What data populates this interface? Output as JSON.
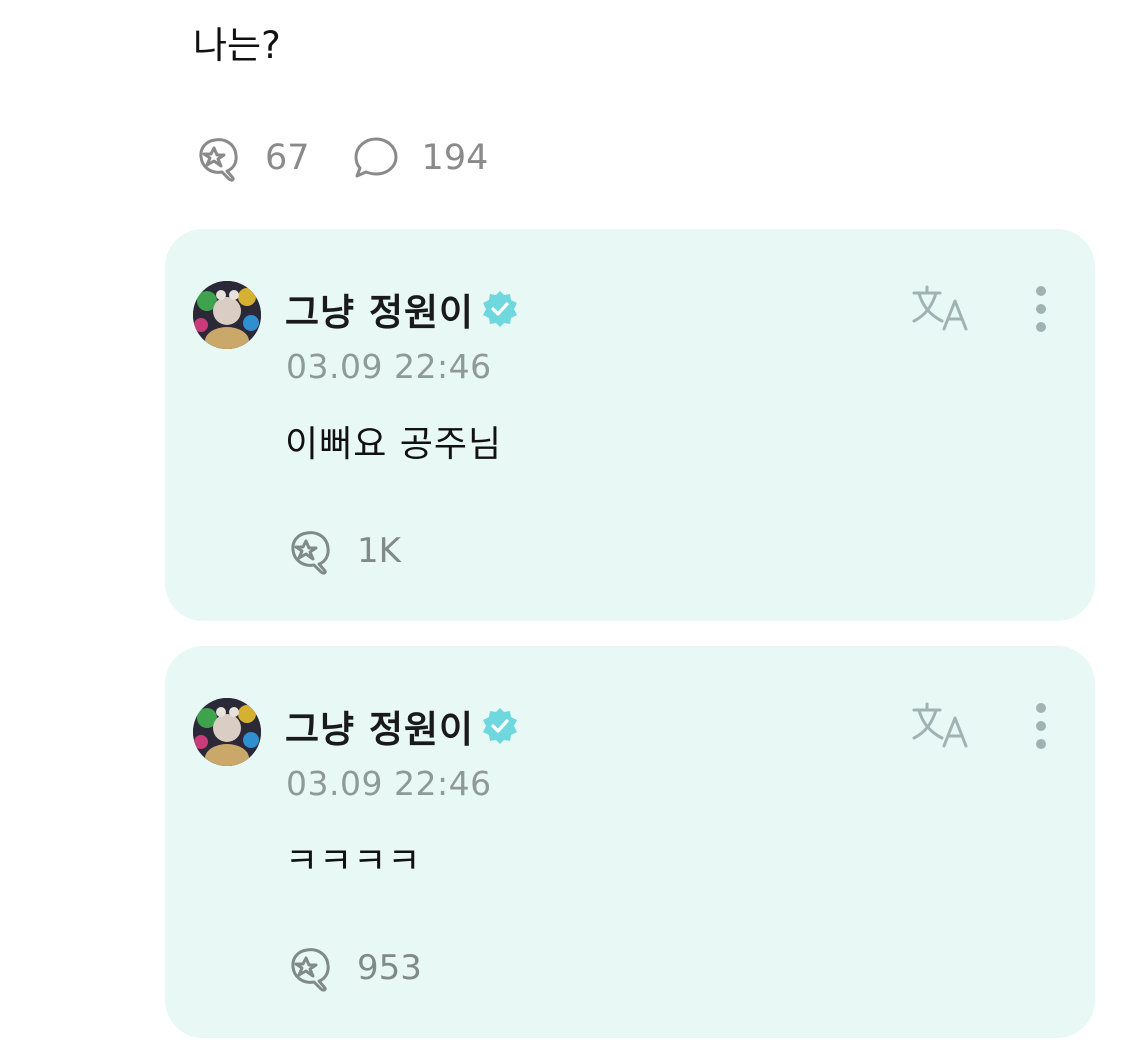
{
  "post": {
    "text": "나는?",
    "likes": "67",
    "comments": "194"
  },
  "comments": [
    {
      "author": "그냥 정원이",
      "verified": true,
      "timestamp": "03.09 22:46",
      "text": "이뻐요 공주님",
      "likes": "1K"
    },
    {
      "author": "그냥 정원이",
      "verified": true,
      "timestamp": "03.09 22:46",
      "text": "ㅋㅋㅋㅋ",
      "likes": "953"
    }
  ],
  "icons": {
    "like": "like-icon",
    "comment": "comment-icon",
    "translate": "translate-icon",
    "more": "more-vertical-icon",
    "verified": "verified-badge-icon"
  },
  "colors": {
    "comment_bg": "#e8f8f5",
    "verified": "#6fd8df",
    "muted": "#8a8a8a"
  }
}
